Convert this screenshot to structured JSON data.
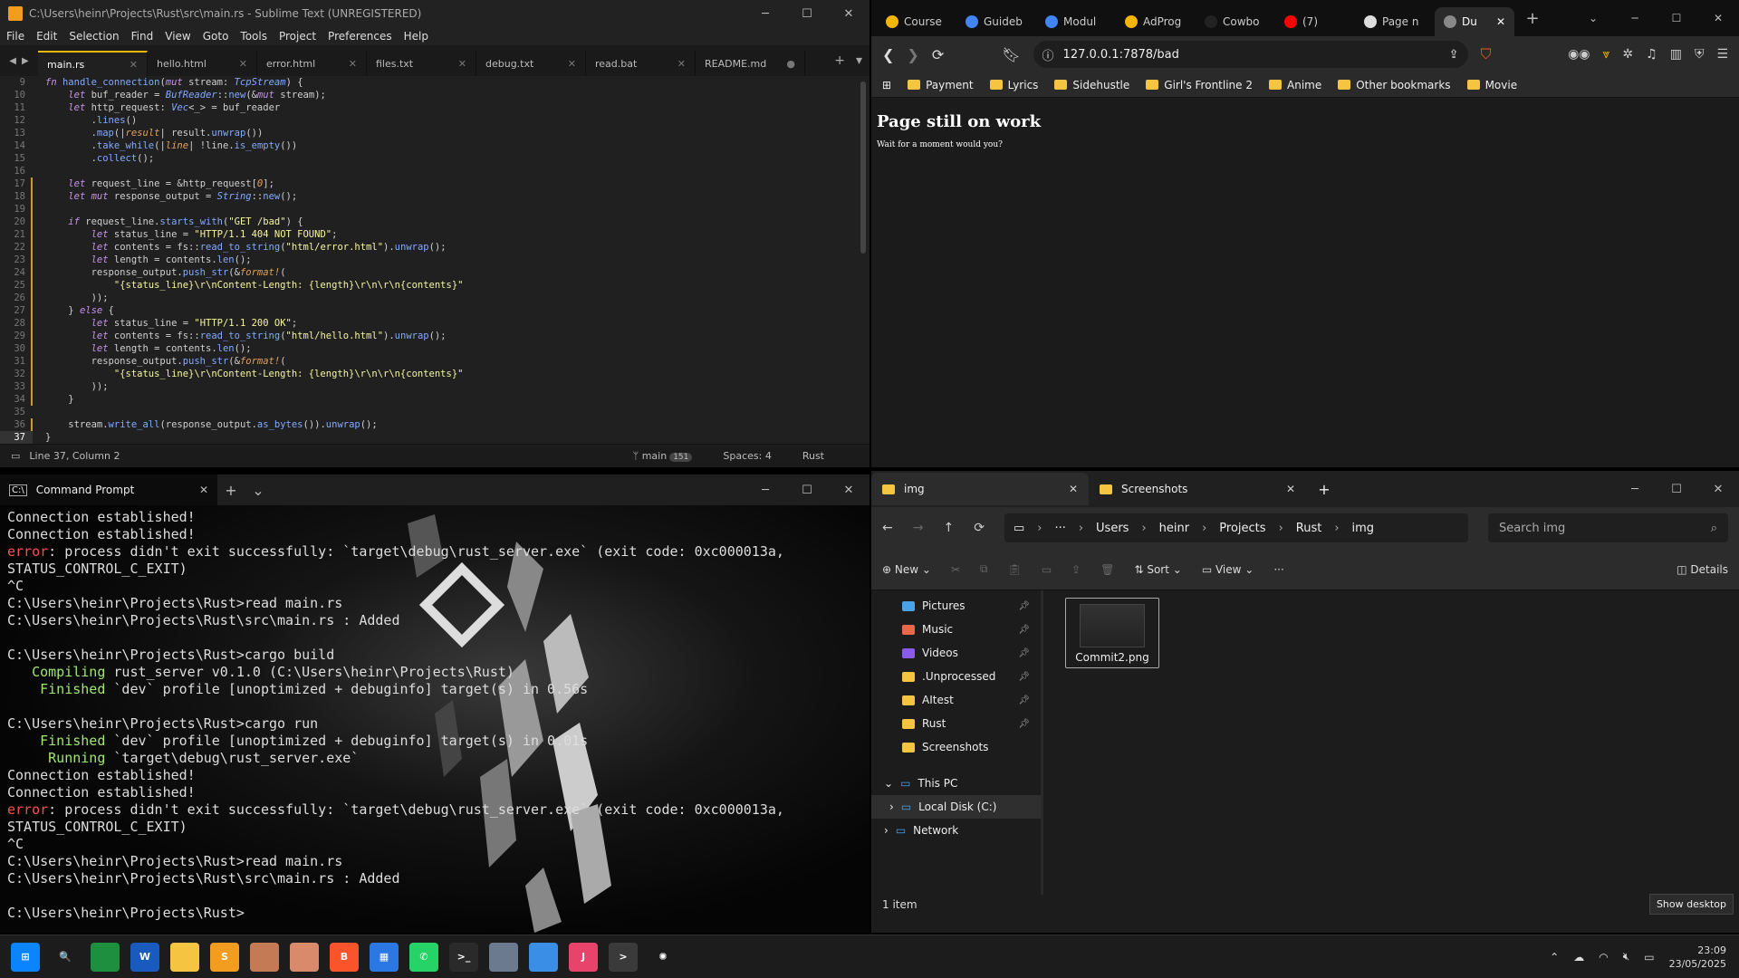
{
  "sublime": {
    "title": "C:\\Users\\heinr\\Projects\\Rust\\src\\main.rs - Sublime Text (UNREGISTERED)",
    "menu": [
      "File",
      "Edit",
      "Selection",
      "Find",
      "View",
      "Goto",
      "Tools",
      "Project",
      "Preferences",
      "Help"
    ],
    "tabs": [
      "main.rs",
      "hello.html",
      "error.html",
      "files.txt",
      "debug.txt",
      "read.bat",
      "README.md"
    ],
    "active_tab": 0,
    "status": {
      "position": "Line 37, Column 2",
      "branch": "main",
      "branch_count": "151",
      "spaces": "Spaces: 4",
      "syntax": "Rust"
    },
    "lines": [
      {
        "n": "9",
        "html": "<span class='kw'>fn</span> <span class='fn'>handle_connection</span>(<span class='kw'>mut</span> stream: <span class='ty'>TcpStream</span>) {"
      },
      {
        "n": "10",
        "html": "    <span class='kw'>let</span> buf_reader = <span class='ty'>BufReader</span>::<span class='fn'>new</span>(&amp;<span class='kw'>mut</span> stream);"
      },
      {
        "n": "11",
        "html": "    <span class='kw'>let</span> http_request: <span class='ty'>Vec</span>&lt;_&gt; = buf_reader"
      },
      {
        "n": "12",
        "html": "        .<span class='fn'>lines</span>()"
      },
      {
        "n": "13",
        "html": "        .<span class='fn'>map</span>(|<span class='mac'>result</span>| result.<span class='fn'>unwrap</span>())"
      },
      {
        "n": "14",
        "html": "        .<span class='fn'>take_while</span>(|<span class='mac'>line</span>| !line.<span class='fn'>is_empty</span>())"
      },
      {
        "n": "15",
        "html": "        .<span class='fn'>collect</span>();"
      },
      {
        "n": "16",
        "html": ""
      },
      {
        "n": "17",
        "html": "    <span class='kw'>let</span> request_line = &amp;http_request[<span class='mac'>0</span>];",
        "mod": true
      },
      {
        "n": "18",
        "html": "    <span class='kw'>let</span> <span class='kw'>mut</span> response_output = <span class='ty'>String</span>::<span class='fn'>new</span>();",
        "mod": true
      },
      {
        "n": "19",
        "html": "",
        "mod": true
      },
      {
        "n": "20",
        "html": "    <span class='kw'>if</span> request_line.<span class='fn'>starts_with</span>(<span class='st'>\"GET /bad\"</span>) {",
        "mod": true
      },
      {
        "n": "21",
        "html": "        <span class='kw'>let</span> status_line = <span class='st'>\"HTTP/1.1 404 NOT FOUND\"</span>;",
        "mod": true
      },
      {
        "n": "22",
        "html": "        <span class='kw'>let</span> contents = fs::<span class='fn'>read_to_string</span>(<span class='st'>\"html/error.html\"</span>).<span class='fn'>unwrap</span>();",
        "mod": true
      },
      {
        "n": "23",
        "html": "        <span class='kw'>let</span> length = contents.<span class='fn'>len</span>();",
        "mod": true
      },
      {
        "n": "24",
        "html": "        response_output.<span class='fn'>push_str</span>(&amp;<span class='mac'>format!</span>(",
        "mod": true
      },
      {
        "n": "25",
        "html": "            <span class='st'>\"{status_line}\\r\\nContent-Length: {length}\\r\\n\\r\\n{contents}\"</span>",
        "mod": true
      },
      {
        "n": "26",
        "html": "        ));",
        "mod": true
      },
      {
        "n": "27",
        "html": "    } <span class='kw'>else</span> {",
        "mod": true
      },
      {
        "n": "28",
        "html": "        <span class='kw'>let</span> status_line = <span class='st'>\"HTTP/1.1 200 OK\"</span>;",
        "mod": true
      },
      {
        "n": "29",
        "html": "        <span class='kw'>let</span> contents = fs::<span class='fn'>read_to_string</span>(<span class='st'>\"html/hello.html\"</span>).<span class='fn'>unwrap</span>();",
        "mod": true
      },
      {
        "n": "30",
        "html": "        <span class='kw'>let</span> length = contents.<span class='fn'>len</span>();",
        "mod": true
      },
      {
        "n": "31",
        "html": "        response_output.<span class='fn'>push_str</span>(&amp;<span class='mac'>format!</span>(",
        "mod": true
      },
      {
        "n": "32",
        "html": "            <span class='st'>\"{status_line}\\r\\nContent-Length: {length}\\r\\n\\r\\n{contents}\"</span>",
        "mod": true
      },
      {
        "n": "33",
        "html": "        ));",
        "mod": true
      },
      {
        "n": "34",
        "html": "    }",
        "mod": true
      },
      {
        "n": "35",
        "html": ""
      },
      {
        "n": "36",
        "html": "    stream.<span class='fn'>write_all</span>(response_output.<span class='fn'>as_bytes</span>()).<span class='fn'>unwrap</span>();",
        "mod": true
      },
      {
        "n": "37",
        "html": "}",
        "cur": true
      }
    ]
  },
  "browser": {
    "tabs": [
      {
        "label": "Course",
        "color": "#f5b400"
      },
      {
        "label": "Guideb",
        "color": "#4285f4"
      },
      {
        "label": "Modul",
        "color": "#4285f4"
      },
      {
        "label": "AdProg",
        "color": "#f5b400"
      },
      {
        "label": "Cowbo",
        "color": "#222222"
      },
      {
        "label": "(7)",
        "color": "#ff0000"
      },
      {
        "label": "Page n",
        "color": "#dddddd"
      },
      {
        "label": "Du",
        "color": "#888888"
      }
    ],
    "active_tab": 7,
    "url": "127.0.0.1:7878/bad",
    "bookmarks": [
      "Payment",
      "Lyrics",
      "Sidehustle",
      "Girl's Frontline 2",
      "Anime",
      "Other bookmarks",
      "Movie"
    ],
    "page_heading": "Page still on work",
    "page_text": "Wait for a moment would you?"
  },
  "terminal": {
    "tab_title": "Command Prompt",
    "lines": [
      {
        "text": "Connection established!"
      },
      {
        "text": "Connection established!"
      },
      {
        "prefix": "error",
        "text": ": process didn't exit successfully: `target\\debug\\rust_server.exe` (exit code: 0xc000013a, STATUS_CONTROL_C_EXIT)",
        "type": "err"
      },
      {
        "text": "^C"
      },
      {
        "text": "C:\\Users\\heinr\\Projects\\Rust>read main.rs"
      },
      {
        "text": "C:\\Users\\heinr\\Projects\\Rust\\src\\main.rs : Added"
      },
      {
        "text": ""
      },
      {
        "text": "C:\\Users\\heinr\\Projects\\Rust>cargo build"
      },
      {
        "prefix": "   Compiling",
        "text": " rust_server v0.1.0 (C:\\Users\\heinr\\Projects\\Rust)",
        "type": "green"
      },
      {
        "prefix": "    Finished",
        "text": " `dev` profile [unoptimized + debuginfo] target(s) in 0.56s",
        "type": "green"
      },
      {
        "text": ""
      },
      {
        "text": "C:\\Users\\heinr\\Projects\\Rust>cargo run"
      },
      {
        "prefix": "    Finished",
        "text": " `dev` profile [unoptimized + debuginfo] target(s) in 0.01s",
        "type": "green"
      },
      {
        "prefix": "     Running",
        "text": " `target\\debug\\rust_server.exe`",
        "type": "green"
      },
      {
        "text": "Connection established!"
      },
      {
        "text": "Connection established!"
      },
      {
        "prefix": "error",
        "text": ": process didn't exit successfully: `target\\debug\\rust_server.exe` (exit code: 0xc000013a, STATUS_CONTROL_C_EXIT)",
        "type": "err"
      },
      {
        "text": "^C"
      },
      {
        "text": "C:\\Users\\heinr\\Projects\\Rust>read main.rs"
      },
      {
        "text": "C:\\Users\\heinr\\Projects\\Rust\\src\\main.rs : Added"
      },
      {
        "text": ""
      },
      {
        "text": "C:\\Users\\heinr\\Projects\\Rust>"
      }
    ]
  },
  "explorer": {
    "tabs": [
      "img",
      "Screenshots"
    ],
    "breadcrumb": [
      "Users",
      "heinr",
      "Projects",
      "Rust",
      "img"
    ],
    "search_placeholder": "Search img",
    "commands": {
      "new": "New",
      "sort": "Sort",
      "view": "View",
      "details": "Details"
    },
    "nav": [
      {
        "label": "Pictures",
        "icon": "pictures",
        "pinned": true
      },
      {
        "label": "Music",
        "icon": "music",
        "pinned": true
      },
      {
        "label": "Videos",
        "icon": "videos",
        "pinned": true
      },
      {
        "label": ".Unprocessed",
        "icon": "folder",
        "pinned": true
      },
      {
        "label": "AItest",
        "icon": "folder",
        "pinned": true
      },
      {
        "label": "Rust",
        "icon": "folder",
        "pinned": true
      },
      {
        "label": "Screenshots",
        "icon": "folder",
        "pinned": false
      }
    ],
    "tree": [
      {
        "label": "This PC",
        "expander": "v"
      },
      {
        "label": "Local Disk (C:)",
        "expander": ">",
        "selected": true,
        "indent": true
      },
      {
        "label": "Network",
        "expander": ">"
      }
    ],
    "file": "Commit2.png",
    "status": "1 item",
    "show_desktop": "Show desktop"
  },
  "taskbar": {
    "apps": [
      {
        "name": "start",
        "color": "#0a84ff",
        "glyph": "⊞"
      },
      {
        "name": "search",
        "color": "transparent",
        "glyph": "🔍"
      },
      {
        "name": "excel-like",
        "color": "#1e8f3e",
        "glyph": ""
      },
      {
        "name": "word",
        "color": "#185abd",
        "glyph": "W"
      },
      {
        "name": "file-explorer",
        "color": "#f5c542",
        "glyph": ""
      },
      {
        "name": "sublime",
        "color": "#f29d1f",
        "glyph": "S"
      },
      {
        "name": "game-1",
        "color": "#c47a55",
        "glyph": ""
      },
      {
        "name": "game-2",
        "color": "#d88a6a",
        "glyph": ""
      },
      {
        "name": "brave",
        "color": "#fb542b",
        "glyph": "B"
      },
      {
        "name": "app-blue",
        "color": "#2b78e4",
        "glyph": "▦"
      },
      {
        "name": "whatsapp",
        "color": "#25d366",
        "glyph": "✆"
      },
      {
        "name": "terminal",
        "color": "#2a2a2a",
        "glyph": ">_"
      },
      {
        "name": "app-gray",
        "color": "#6b7a8f",
        "glyph": ""
      },
      {
        "name": "photos",
        "color": "#3a8ee6",
        "glyph": ""
      },
      {
        "name": "jetbrains",
        "color": "#e8436a",
        "glyph": "J"
      },
      {
        "name": "terminal-2",
        "color": "#3a3a3a",
        "glyph": ">"
      },
      {
        "name": "chatgpt",
        "color": "transparent",
        "glyph": "✺"
      }
    ],
    "time": "23:09",
    "date": "23/05/2025"
  }
}
